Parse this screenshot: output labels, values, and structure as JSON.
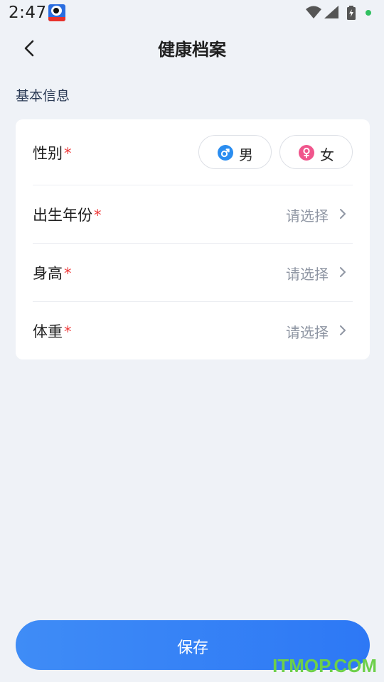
{
  "status_bar": {
    "time": "2:47",
    "app_icon": "app-logo-icon",
    "icons": [
      "wifi-icon",
      "signal-icon",
      "battery-icon",
      "notification-dot-icon"
    ]
  },
  "header": {
    "title": "健康档案",
    "back_icon": "chevron-left-icon"
  },
  "section": {
    "title": "基本信息"
  },
  "form": {
    "required_mark": "*",
    "gender": {
      "label": "性别",
      "options": [
        {
          "label": "男",
          "icon": "male-symbol-icon",
          "color": "#2a8df0"
        },
        {
          "label": "女",
          "icon": "female-symbol-icon",
          "color": "#f0558c"
        }
      ]
    },
    "birth_year": {
      "label": "出生年份",
      "value": "请选择"
    },
    "height": {
      "label": "身高",
      "value": "请选择"
    },
    "weight": {
      "label": "体重",
      "value": "请选择"
    }
  },
  "actions": {
    "save_label": "保存"
  },
  "watermark": "ITMOP.COM",
  "colors": {
    "background": "#eff2f7",
    "accent": "#2d78f5",
    "required": "#ee3b3b",
    "placeholder": "#8f96a3"
  }
}
